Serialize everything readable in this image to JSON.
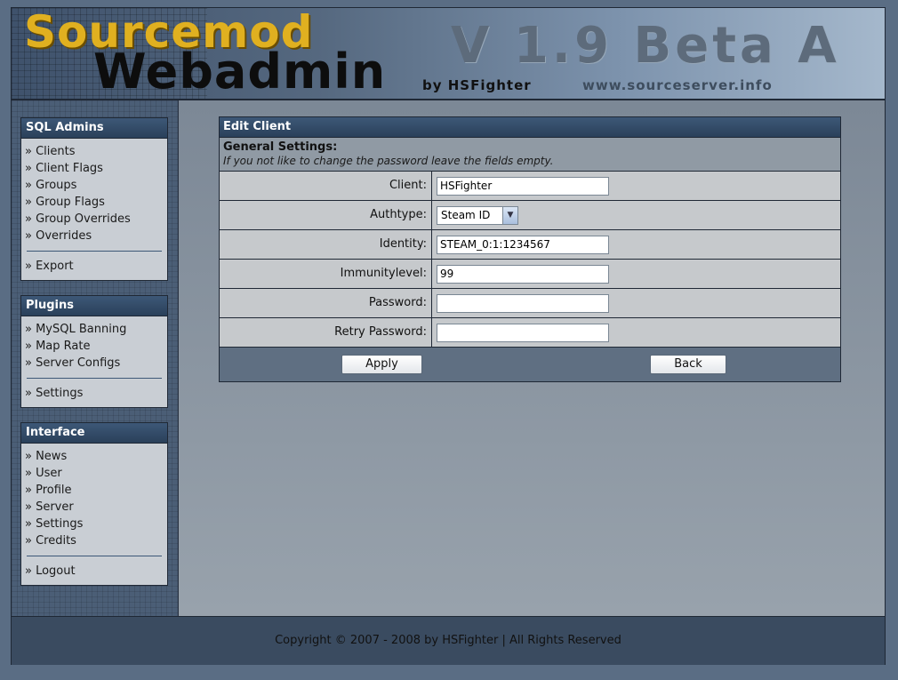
{
  "header": {
    "logo_line1": "Sourcemod",
    "logo_line2": "Webadmin",
    "by": "by HSFighter",
    "version": "V 1.9 Beta A",
    "url": "www.sourceserver.info"
  },
  "sidebar": {
    "sql_admins": {
      "title": "SQL Admins",
      "items": [
        "» Clients",
        "» Client Flags",
        "» Groups",
        "» Group Flags",
        "» Group Overrides",
        "» Overrides"
      ],
      "extra": [
        "» Export"
      ]
    },
    "plugins": {
      "title": "Plugins",
      "items": [
        "» MySQL Banning",
        "» Map Rate",
        "» Server Configs"
      ],
      "extra": [
        "» Settings"
      ]
    },
    "interface": {
      "title": "Interface",
      "items": [
        "» News",
        "» User",
        "» Profile",
        "» Server",
        "» Settings",
        "» Credits"
      ],
      "extra": [
        "» Logout"
      ]
    }
  },
  "panel": {
    "title": "Edit Client",
    "section_title": "General Settings:",
    "section_note": "If you not like to change the password leave the fields empty.",
    "fields": {
      "client": {
        "label": "Client:",
        "value": "HSFighter"
      },
      "authtype": {
        "label": "Authtype:",
        "value": "Steam ID"
      },
      "identity": {
        "label": "Identity:",
        "value": "STEAM_0:1:1234567"
      },
      "immunity": {
        "label": "Immunitylevel:",
        "value": "99"
      },
      "password": {
        "label": "Password:",
        "value": ""
      },
      "retry": {
        "label": "Retry Password:",
        "value": ""
      }
    },
    "apply_label": "Apply",
    "back_label": "Back"
  },
  "footer": {
    "copyright": "Copyright © 2007 - 2008 by HSFighter | All Rights Reserved"
  }
}
